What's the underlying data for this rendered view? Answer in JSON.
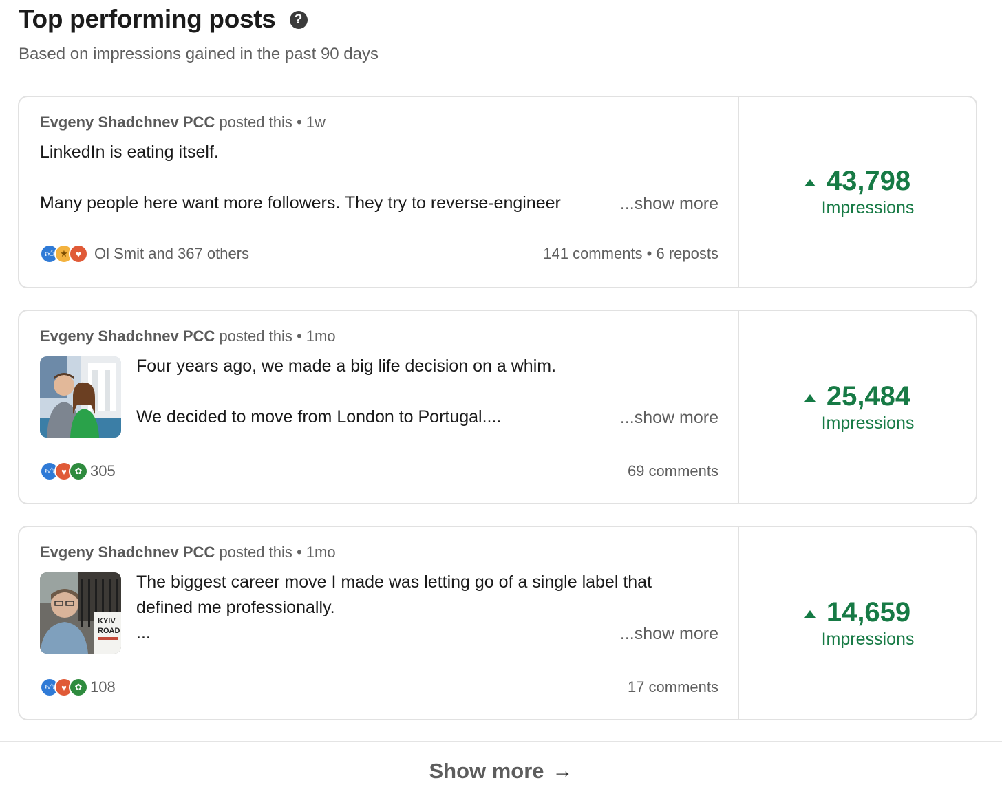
{
  "header": {
    "title": "Top performing posts",
    "subtitle": "Based on impressions gained in the past 90 days",
    "help_icon": "help-icon"
  },
  "posts": [
    {
      "author": "Evgeny Shadchnev PCC",
      "posted_label": "posted this",
      "age": "1w",
      "line1": "LinkedIn is eating itself.",
      "line2": "Many people here want more followers. They try to reverse-engineer",
      "show_more": "...show more",
      "reactions_label": "Ol Smit and 367 others",
      "reaction_icons": [
        "like-icon",
        "insightful-icon",
        "love-icon"
      ],
      "engagement": "141 comments",
      "reposts": "6 reposts",
      "impressions": "43,798",
      "impressions_label": "Impressions"
    },
    {
      "author": "Evgeny Shadchnev PCC",
      "posted_label": "posted this",
      "age": "1mo",
      "line1": "Four years ago, we made a big life decision on a whim.",
      "line2": "We decided to move from London to Portugal....",
      "show_more": "...show more",
      "reactions_label": "305",
      "reaction_icons": [
        "like-icon",
        "love-icon",
        "support-icon"
      ],
      "engagement": "69 comments",
      "impressions": "25,484",
      "impressions_label": "Impressions"
    },
    {
      "author": "Evgeny Shadchnev PCC",
      "posted_label": "posted this",
      "age": "1mo",
      "line1": "The biggest career move I made was letting go of a single label that",
      "line2": "defined me professionally.",
      "line3": "...",
      "show_more": "...show more",
      "reactions_label": "108",
      "reaction_icons": [
        "like-icon",
        "love-icon",
        "support-icon"
      ],
      "engagement": "17 comments",
      "impressions": "14,659",
      "impressions_label": "Impressions",
      "thumb_sign": "KYIV ROAD"
    }
  ],
  "footer": {
    "show_more": "Show more"
  },
  "colors": {
    "impressions_green": "#177a45",
    "border": "#e1e1e1"
  }
}
